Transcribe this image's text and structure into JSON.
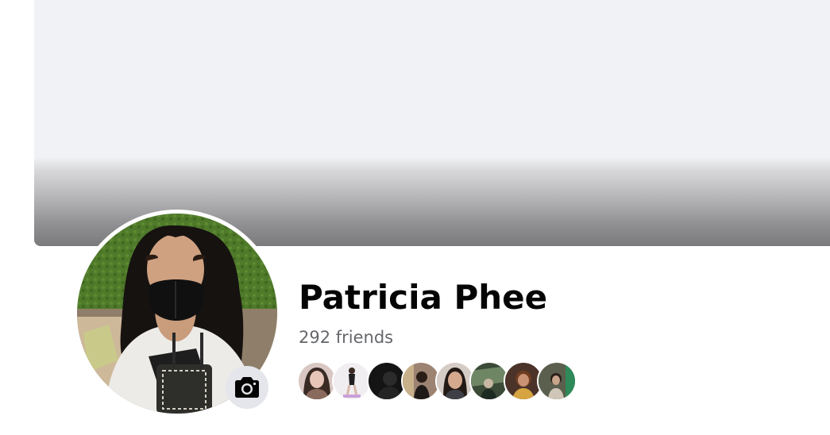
{
  "profile": {
    "name": "Patricia Phee",
    "friends_count": "292 friends"
  },
  "friend_avatars": [
    {
      "description": "friend-1",
      "tone": "#c9b2ac"
    },
    {
      "description": "friend-2",
      "tone": "#ece7ee"
    },
    {
      "description": "friend-3",
      "tone": "#1c1c1c"
    },
    {
      "description": "friend-4",
      "tone": "#8a7263"
    },
    {
      "description": "friend-5",
      "tone": "#c7b9b1"
    },
    {
      "description": "friend-6",
      "tone": "#55624f"
    },
    {
      "description": "friend-7",
      "tone": "#5a4034"
    },
    {
      "description": "friend-8",
      "tone": "#6e715f"
    }
  ],
  "icons": {
    "camera": "camera-icon"
  },
  "colors": {
    "cover_light": "#f0f2f5",
    "cover_dark": "#7a7a7c",
    "name_text": "#050505",
    "secondary_text": "#65676b",
    "camera_button_bg": "#e4e6eb"
  }
}
